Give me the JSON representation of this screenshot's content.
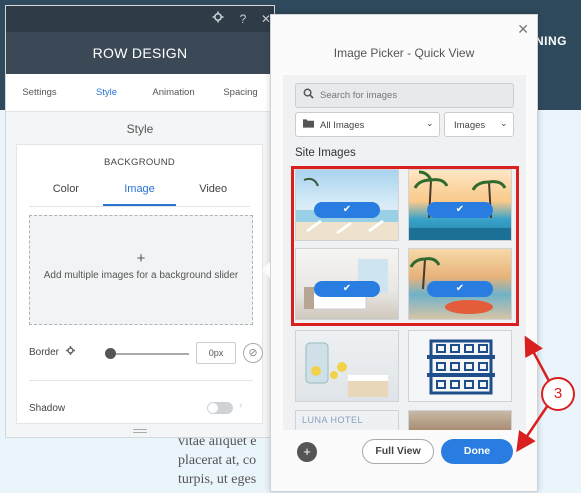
{
  "background_page": {
    "heading": "NING",
    "body_lines": [
      "vitae aliquet e",
      "placerat at, co",
      "turpis, ut eges"
    ]
  },
  "row_panel": {
    "title": "ROW DESIGN",
    "toolbar_icons": [
      "gear-icon",
      "help-icon",
      "close-icon"
    ],
    "help_glyph": "?",
    "tabs": [
      {
        "label": "Settings"
      },
      {
        "label": "Style",
        "active": true
      },
      {
        "label": "Animation"
      },
      {
        "label": "Spacing"
      }
    ],
    "section_title": "Style",
    "background": {
      "label": "BACKGROUND",
      "tabs": [
        {
          "label": "Color"
        },
        {
          "label": "Image",
          "active": true
        },
        {
          "label": "Video"
        }
      ],
      "dropzone_plus": "+",
      "dropzone_text": "Add multiple images for a background slider"
    },
    "border": {
      "label": "Border",
      "value": "0px"
    },
    "shadow": {
      "label": "Shadow",
      "enabled": false
    }
  },
  "picker": {
    "title": "Image Picker - Quick View",
    "search_placeholder": "Search for images",
    "filter_all": "All Images",
    "filter_type": "Images",
    "section_label": "Site Images",
    "images": [
      {
        "subject": "beach-chairs",
        "selected": true
      },
      {
        "subject": "palm-pool",
        "selected": true
      },
      {
        "subject": "hotel-room",
        "selected": true
      },
      {
        "subject": "sunset-beach",
        "selected": true
      },
      {
        "subject": "jars-cake",
        "selected": false
      },
      {
        "subject": "building-icon",
        "selected": false
      },
      {
        "subject": "hotel-logo",
        "selected": false,
        "caption": "LUNA HOTEL"
      },
      {
        "subject": "bedroom",
        "selected": false
      }
    ],
    "add_label": "+",
    "full_view_label": "Full View",
    "done_label": "Done"
  },
  "annotation": {
    "number": "3",
    "color": "#d9201f"
  },
  "colors": {
    "accent": "#2a7de0",
    "highlight": "#d9201f",
    "panel_header": "#3b4956"
  }
}
